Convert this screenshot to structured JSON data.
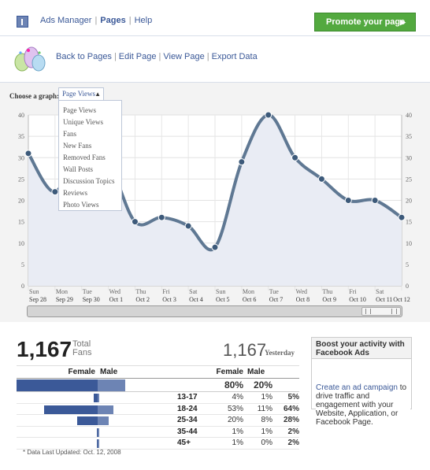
{
  "nav": {
    "items": [
      "Ads Manager",
      "Pages",
      "Help"
    ],
    "active": "Pages",
    "promote_label": "Promote your page",
    "promote_arrow": "▶"
  },
  "page_links": [
    "Back to Pages",
    "Edit Page",
    "View Page",
    "Export Data"
  ],
  "graph": {
    "choose_label": "Choose a graph:",
    "selected": "Page Views",
    "caret": "▲",
    "options": [
      "Page Views",
      "Unique Views",
      "Fans",
      "New Fans",
      "Removed Fans",
      "Wall Posts",
      "Discussion Topics",
      "Reviews",
      "Photo Views"
    ]
  },
  "chart_data": {
    "type": "line",
    "x_days": [
      "Sun",
      "Mon",
      "Tue",
      "Wed",
      "Thu",
      "Fri",
      "Sat",
      "Sun",
      "Mon",
      "Tue",
      "Wed",
      "Thu",
      "Fri",
      "Sat",
      ""
    ],
    "x_dates": [
      "Sep 28",
      "Sep 29",
      "Sep 30",
      "Oct 1",
      "Oct 2",
      "Oct 3",
      "Oct 4",
      "Oct 5",
      "Oct 6",
      "Oct 7",
      "Oct 8",
      "Oct 9",
      "Oct 10",
      "Oct 11",
      "Oct 12"
    ],
    "values": [
      31,
      22,
      33,
      29,
      15,
      16,
      14,
      9,
      29,
      40,
      30,
      25,
      20,
      20,
      16
    ],
    "ylim": [
      0,
      40
    ],
    "yticks": [
      0,
      5,
      10,
      15,
      20,
      25,
      30,
      35,
      40
    ],
    "grid": true,
    "line_color": "#5f7893",
    "fill_color": "#e9ecf4"
  },
  "stats": {
    "total_fans": "1,167",
    "total_label_1": "Total",
    "total_label_2": "Fans",
    "yesterday_num": "1,167",
    "yesterday_label": "Yesterday",
    "headers": {
      "female": "Female",
      "male": "Male"
    },
    "total_row": {
      "female": "80%",
      "male": "20%",
      "female_frac": 0.8,
      "male_frac": 0.2
    },
    "rows": [
      {
        "age": "13-17",
        "female": "4%",
        "male": "1%",
        "total": "5%",
        "f": 0.04,
        "m": 0.01
      },
      {
        "age": "18-24",
        "female": "53%",
        "male": "11%",
        "total": "64%",
        "f": 0.53,
        "m": 0.11
      },
      {
        "age": "25-34",
        "female": "20%",
        "male": "8%",
        "total": "28%",
        "f": 0.2,
        "m": 0.08
      },
      {
        "age": "35-44",
        "female": "1%",
        "male": "1%",
        "total": "2%",
        "f": 0.01,
        "m": 0.01
      },
      {
        "age": "45+",
        "female": "1%",
        "male": "0%",
        "total": "2%",
        "f": 0.01,
        "m": 0.0
      }
    ],
    "footnote": "* Data Last Updated: Oct. 12, 2008"
  },
  "boost": {
    "title": "Boost your activity with Facebook Ads",
    "link": "Create an ad campaign",
    "text": " to drive traffic and engagement with your Website, Application, or Facebook Page."
  }
}
